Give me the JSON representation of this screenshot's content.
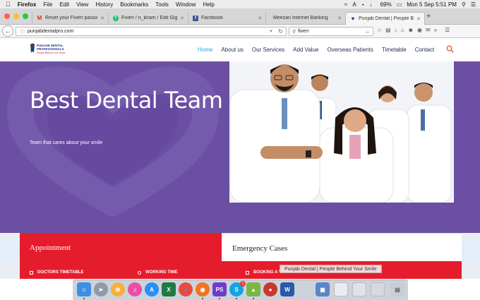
{
  "menubar": {
    "apple": "",
    "items": [
      "Firefox",
      "File",
      "Edit",
      "View",
      "History",
      "Bookmarks",
      "Tools",
      "Window",
      "Help"
    ],
    "battery": "69%",
    "clock": "Mon 5 Sep  5:51 PM"
  },
  "tabs": [
    {
      "label": "Reset your Fiverr password...",
      "icon": "gmail-icon",
      "color": "#d93025"
    },
    {
      "label": "Fiverr / n_ikram / Edit Gig",
      "icon": "fiverr-icon",
      "color": "#1dbf73"
    },
    {
      "label": "Facebook",
      "icon": "facebook-icon",
      "color": "#3b5998"
    },
    {
      "label": "Meezan Internet Banking",
      "icon": "",
      "color": ""
    },
    {
      "label": "Punjab Dental | People Beh...",
      "icon": "tooth-icon",
      "color": "#1f3b7a"
    }
  ],
  "navbar": {
    "url": "punjabdentalpro.com",
    "search": "fiverr"
  },
  "site": {
    "logo_line1": "PUNJAB DENTAL",
    "logo_line2": "PROFESSIONALS",
    "logo_tagline": "People Behind Your Smile",
    "nav": [
      "Home",
      "About us",
      "Our Services",
      "Add Value",
      "Overseas Patients",
      "Timetable",
      "Contact"
    ],
    "hero_title": "Best Dental Team",
    "hero_sub": "Team that cares about your smile",
    "appointment_title": "Appointment",
    "emergency_title": "Emergency  Cases",
    "sub_items": [
      "DOCTORS TIMETABLE",
      "WORKING TIME",
      "BOOKING A VISIT"
    ],
    "tooltip": "Punjab Dental | People Behind Your Smile"
  },
  "colors": {
    "hero_purple": "#6b4fa2",
    "accent_red": "#e51c2c",
    "nav_active": "#2aa6e0"
  },
  "dock": {
    "apps": [
      "finder-icon",
      "launchpad-icon",
      "photos-icon",
      "itunes-icon",
      "appstore-icon",
      "excel-icon",
      "chrome-icon",
      "firefox-icon",
      "phpstorm-icon",
      "skype-icon",
      "android-icon",
      "filezilla-icon",
      "word-icon",
      "preview-icon",
      "documents-icon",
      "downloads-icon",
      "stack-icon",
      "trash-icon"
    ],
    "skype_badge": "1"
  }
}
